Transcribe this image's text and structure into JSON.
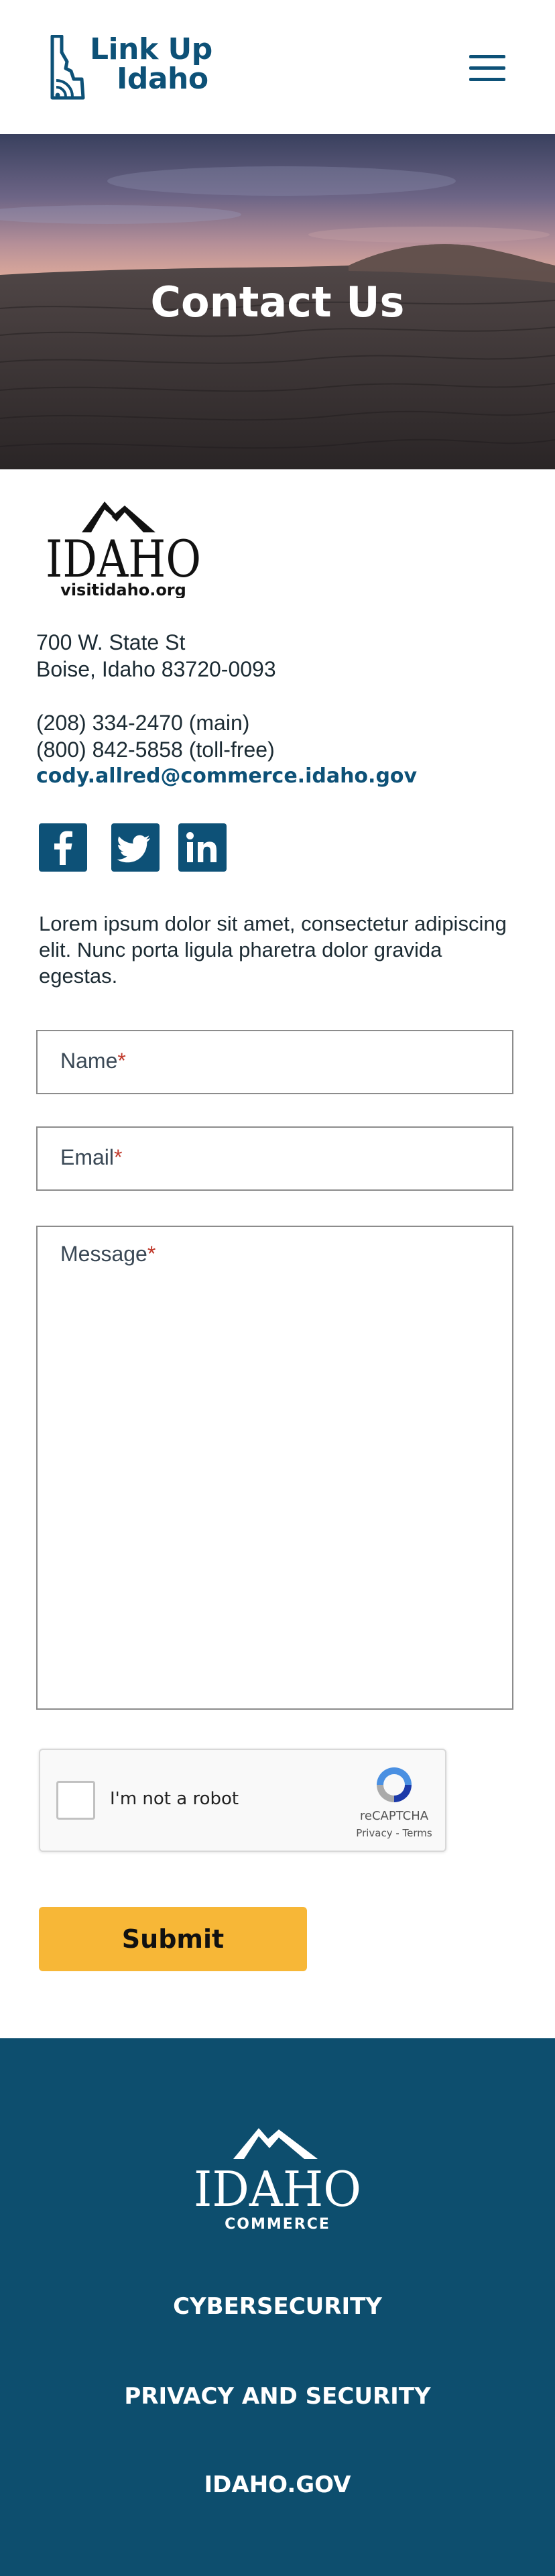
{
  "header": {
    "logo_line1": "Link Up",
    "logo_line2": "Idaho",
    "menu_icon": "hamburger-menu-icon"
  },
  "hero": {
    "title": "Contact Us"
  },
  "contact": {
    "logo_wordmark": "IDAHO",
    "logo_tagline": "visitidaho.org",
    "address_line1": "700 W. State St",
    "address_line2": "Boise, Idaho 83720-0093",
    "phone_main": "(208) 334-2470 (main)",
    "phone_tollfree": "(800) 842-5858 (toll-free)",
    "email": "cody.allred@commerce.idaho.gov",
    "social": [
      {
        "icon": "facebook-icon"
      },
      {
        "icon": "twitter-icon"
      },
      {
        "icon": "linkedin-icon"
      }
    ],
    "description": "Lorem ipsum dolor sit amet, consectetur adipiscing elit. Nunc porta ligula pharetra dolor gravida egestas."
  },
  "form": {
    "name_placeholder": "Name",
    "email_placeholder": "Email",
    "message_placeholder": "Message",
    "required_mark": "*",
    "captcha_label": "I'm not a robot",
    "captcha_brand": "reCAPTCHA",
    "captcha_links": "Privacy - Terms",
    "submit_label": "Submit"
  },
  "footer": {
    "logo_wordmark": "IDAHO",
    "logo_tagline": "COMMERCE",
    "links": [
      "CYBERSECURITY",
      "PRIVACY AND SECURITY",
      "IDAHO.GOV"
    ]
  },
  "colors": {
    "brand_blue": "#0d5177",
    "footer_bg": "#0d4e6e",
    "submit_yellow": "#f7b737",
    "required_red": "#c0392b"
  }
}
